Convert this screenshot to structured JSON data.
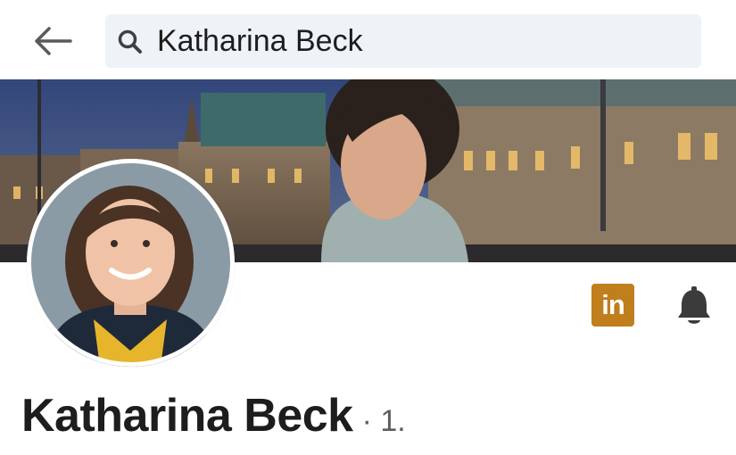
{
  "header": {
    "back_icon": "arrow-left-icon",
    "search": {
      "icon": "search-icon",
      "value": "Katharina Beck"
    }
  },
  "profile": {
    "name": "Katharina Beck",
    "connection_degree": "· 1.",
    "actions": {
      "linkedin_label": "in",
      "linkedin_icon": "linkedin-icon",
      "notify_icon": "bell-icon"
    }
  },
  "colors": {
    "search_bg": "#eef3f8",
    "linkedin_brand": "#c17e1c",
    "text_primary": "#1d1d1d",
    "text_secondary": "#5e5e5e"
  }
}
